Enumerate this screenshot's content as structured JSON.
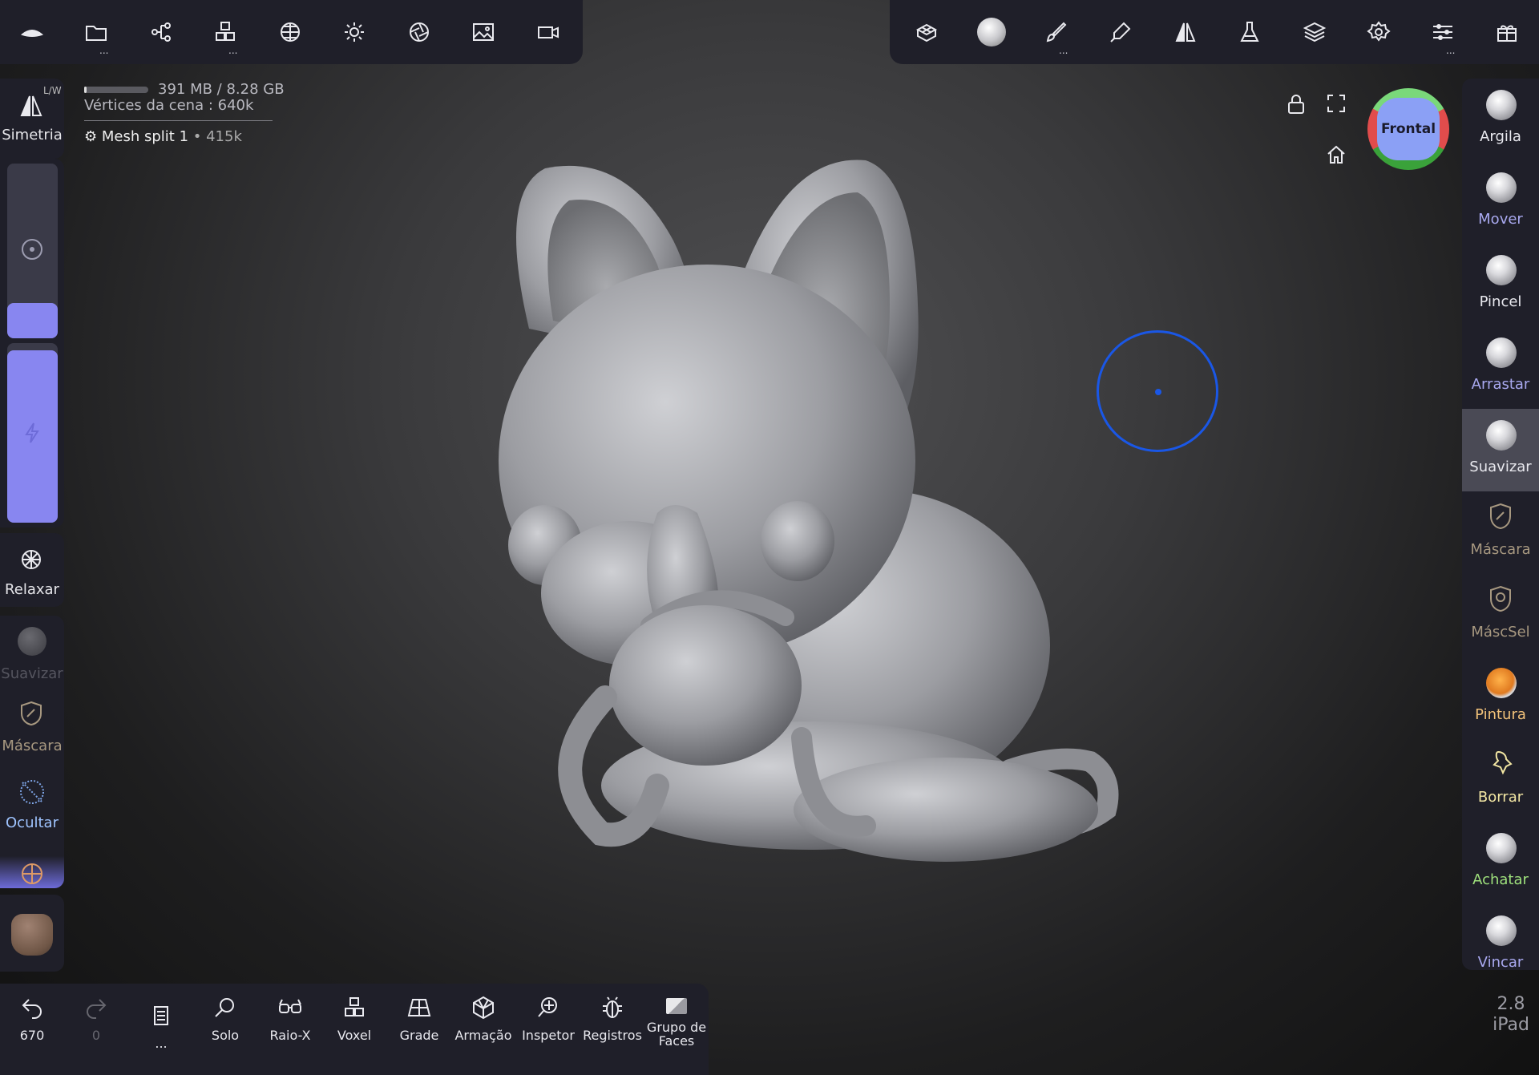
{
  "top_left_tools": [
    {
      "icon": "nomad-logo-icon"
    },
    {
      "icon": "folder-icon",
      "dots": "..."
    },
    {
      "icon": "scene-graph-icon"
    },
    {
      "icon": "primitives-icon",
      "dots": "..."
    },
    {
      "icon": "material-sphere-icon"
    },
    {
      "icon": "light-icon"
    },
    {
      "icon": "camera-aperture-icon"
    },
    {
      "icon": "background-image-icon"
    },
    {
      "icon": "video-camera-icon"
    }
  ],
  "top_right_tools": [
    {
      "icon": "topology-icon"
    },
    {
      "icon": "current-tool-smooth-icon"
    },
    {
      "icon": "brush-stroke-icon",
      "dots": "..."
    },
    {
      "icon": "pen-icon"
    },
    {
      "icon": "symmetry-icon"
    },
    {
      "icon": "flask-icon"
    },
    {
      "icon": "layers-icon"
    },
    {
      "icon": "settings-gear-icon"
    },
    {
      "icon": "sliders-icon",
      "dots": "..."
    },
    {
      "icon": "gift-icon"
    }
  ],
  "stats": {
    "memory": "391 MB / 8.28 GB",
    "memory_fill": 0.04,
    "vertices": "Vértices da cena : 640k",
    "mesh_name": "Mesh split 1",
    "mesh_count": " • 415k"
  },
  "left_panel": {
    "symmetry_label": "Simetria",
    "symmetry_axes": "L/W",
    "radius_fill": 0.2,
    "intensity_fill": 0.96,
    "relax_label": "Relaxar",
    "smooth_label": "Suavizar",
    "mask_label": "Máscara",
    "hide_label": "Ocultar"
  },
  "view": {
    "cube_face": "Frontal"
  },
  "right_tools": [
    {
      "label": "Argila",
      "color": "#e8e8ee"
    },
    {
      "label": "Mover",
      "color": "#a9a9f0"
    },
    {
      "label": "Pincel",
      "color": "#e8e8ee"
    },
    {
      "label": "Arrastar",
      "color": "#a9a9f0"
    },
    {
      "label": "Suavizar",
      "color": "#e8e8ee",
      "active": true
    },
    {
      "label": "Máscara",
      "color": "#a79880"
    },
    {
      "label": "MáscSel",
      "color": "#a79880"
    },
    {
      "label": "Pintura",
      "color": "#f2c27a"
    },
    {
      "label": "Borrar",
      "color": "#f2e6a3"
    },
    {
      "label": "Achatar",
      "color": "#9ee07c"
    },
    {
      "label": "Vincar",
      "color": "#a9a9f0"
    }
  ],
  "bottom_bar": [
    {
      "label": "670",
      "icon": "undo-icon"
    },
    {
      "label": "0",
      "icon": "redo-icon"
    },
    {
      "label": "...",
      "icon": "document-icon"
    },
    {
      "label": "Solo",
      "icon": "search-icon"
    },
    {
      "label": "Raio-X",
      "icon": "glasses-icon"
    },
    {
      "label": "Voxel",
      "icon": "voxel-icon"
    },
    {
      "label": "Grade",
      "icon": "grid-icon"
    },
    {
      "label": "Armação",
      "icon": "wireframe-icon"
    },
    {
      "label": "Inspetor",
      "icon": "inspector-icon"
    },
    {
      "label": "Registros",
      "icon": "bug-icon"
    },
    {
      "label": "Grupo de Faces",
      "icon": "face-group-icon"
    }
  ],
  "version": {
    "number": "2.8",
    "device": "iPad"
  }
}
